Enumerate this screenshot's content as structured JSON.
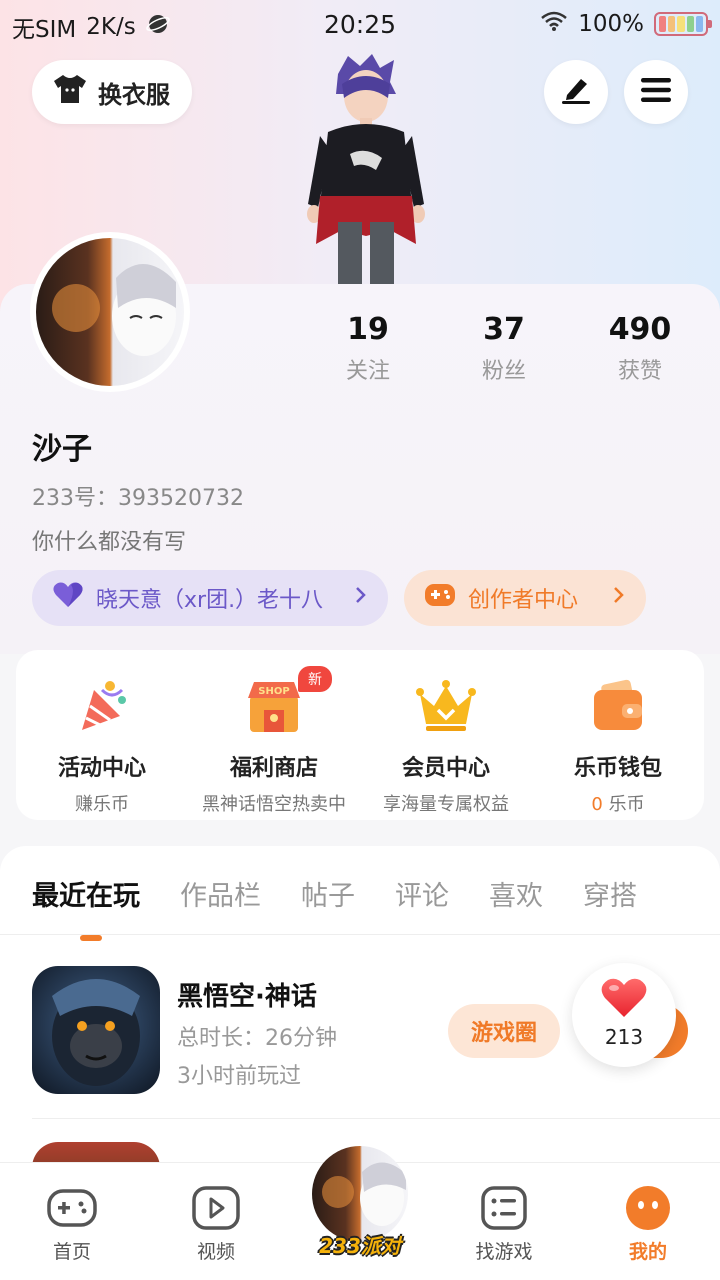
{
  "status_bar": {
    "carrier": "无SIM",
    "speed": "2K/s",
    "time": "20:25",
    "battery": "100%"
  },
  "header": {
    "outfit_label": "换衣服",
    "edit_icon": "pen-icon",
    "menu_icon": "menu-icon"
  },
  "profile": {
    "stats": [
      {
        "value": "19",
        "label": "关注"
      },
      {
        "value": "37",
        "label": "粉丝"
      },
      {
        "value": "490",
        "label": "获赞"
      }
    ],
    "nickname": "沙子",
    "uid": "233号：393520732",
    "bio": "你什么都没有写",
    "group_pill": "晓天意（xr团.）老十八",
    "creator_pill": "创作者中心"
  },
  "services": [
    {
      "title": "活动中心",
      "sub": "赚乐币",
      "icon": "party-popper-icon"
    },
    {
      "title": "福利商店",
      "sub": "黑神话悟空热卖中",
      "icon": "shop-icon",
      "badge": "新"
    },
    {
      "title": "会员中心",
      "sub": "享海量专属权益",
      "icon": "crown-icon"
    },
    {
      "title": "乐币钱包",
      "sub_coin": "0",
      "sub": " 乐币",
      "icon": "wallet-icon"
    }
  ],
  "tabs": [
    "最近在玩",
    "作品栏",
    "帖子",
    "评论",
    "喜欢",
    "穿搭"
  ],
  "recent_game": {
    "name": "黑悟空·神话",
    "play_time": "总时长：26分钟",
    "last_played": "3小时前玩过",
    "circle_label": "游戏圈",
    "likes": "213"
  },
  "bottom_nav": [
    {
      "label": "首页",
      "icon": "gamepad-icon"
    },
    {
      "label": "视频",
      "icon": "video-play-icon"
    },
    {
      "label": "233派对",
      "icon": "avatar"
    },
    {
      "label": "找游戏",
      "icon": "list-icon"
    },
    {
      "label": "我的",
      "icon": "profile-face-icon"
    }
  ],
  "colors": {
    "accent": "#f27c2a",
    "purple": "#6b58c8"
  }
}
